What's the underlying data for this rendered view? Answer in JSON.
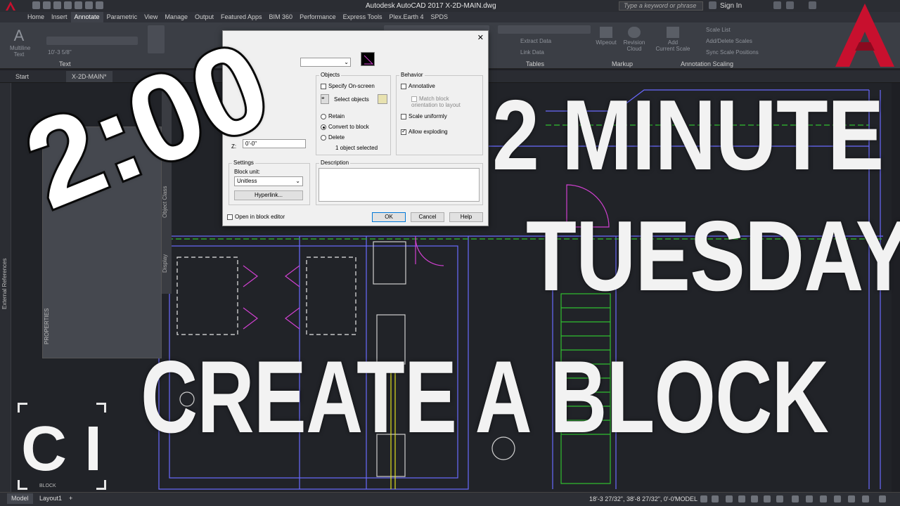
{
  "app": {
    "title": "Autodesk AutoCAD 2017    X-2D-MAIN.dwg",
    "search_placeholder": "Type a keyword or phrase",
    "sign_in": "Sign In"
  },
  "ribbon_tabs": [
    "Home",
    "Insert",
    "Annotate",
    "Parametric",
    "View",
    "Manage",
    "Output",
    "Featured Apps",
    "BIM 360",
    "Performance",
    "Express Tools",
    "Plex.Earth 4",
    "SPDS"
  ],
  "ribbon": {
    "multiline_text": "Multiline\nText",
    "text_height": "10'-3 5/8\"",
    "text_panel": "Text",
    "extract_data": "Extract Data",
    "link_data": "Link Data",
    "tables_panel": "Tables",
    "wipeout": "Wipeout",
    "revision_cloud": "Revision\nCloud",
    "markup_panel": "Markup",
    "add_current_scale": "Add\nCurrent Scale",
    "scale_list": "Scale List",
    "add_delete_scales": "Add/Delete Scales",
    "sync_scale_positions": "Sync Scale Positions",
    "annotation_scaling_panel": "Annotation Scaling"
  },
  "doc_tabs": [
    "Start",
    "X-2D-MAIN*"
  ],
  "palette": {
    "external_references": "External References",
    "properties": "PROPERTIES",
    "object_class": "Object Class",
    "display": "Display"
  },
  "dialog": {
    "objects_title": "Objects",
    "specify_on_screen": "Specify On-screen",
    "select_objects": "Select objects",
    "retain": "Retain",
    "convert_to_block": "Convert to block",
    "delete": "Delete",
    "selected_count": "1 object selected",
    "behavior_title": "Behavior",
    "annotative": "Annotative",
    "match_orientation": "Match block orientation to layout",
    "scale_uniformly": "Scale uniformly",
    "allow_exploding": "Allow exploding",
    "settings_title": "Settings",
    "block_unit": "Block unit:",
    "unit_value": "Unitless",
    "hyperlink": "Hyperlink...",
    "description": "Description",
    "open_in_editor": "Open in block editor",
    "ok": "OK",
    "cancel": "Cancel",
    "help": "Help",
    "z_label": "Z:",
    "z_value": "0'-0\""
  },
  "overlay": {
    "timer": "2:00",
    "line1": "2 MINUTE",
    "line2": "TUESDAY",
    "line3": "CREATE A BLOCK",
    "logo": "C I"
  },
  "status": {
    "model_tab": "Model",
    "layout_tab": "Layout1",
    "add_tab": "+",
    "coords": "18'-3 27/32\", 38'-8 27/32\", 0'-0\"",
    "model": "MODEL",
    "block_tab": "BLOCK"
  },
  "colors": {
    "accent_red": "#c8102e",
    "canvas": "#212328",
    "line_magenta": "#d040d0",
    "line_green": "#30c030",
    "line_blue": "#6a6aff",
    "line_yellow": "#e0e020"
  }
}
